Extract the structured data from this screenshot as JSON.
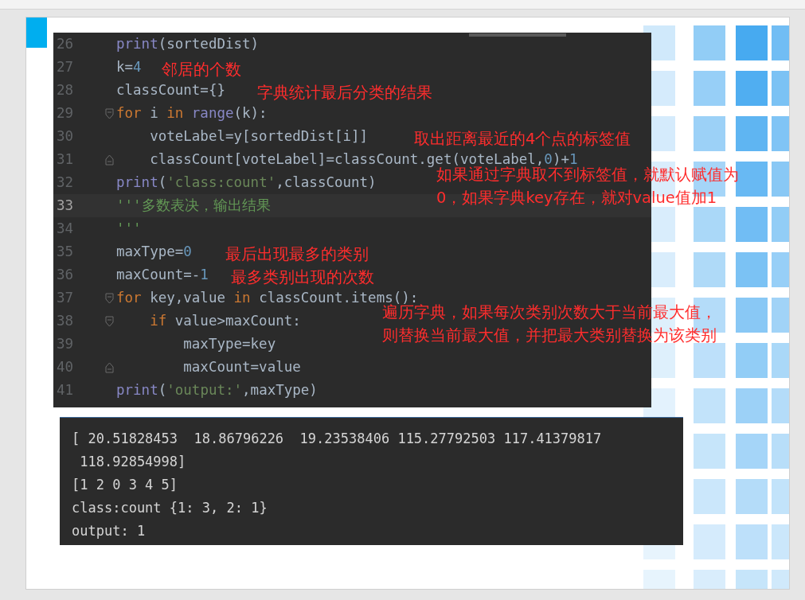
{
  "code_panel": {
    "lines": [
      {
        "number": "26",
        "kind": "plain",
        "current": false,
        "tokens": [
          {
            "kind": "builtin",
            "text": "print"
          },
          {
            "kind": "plain",
            "text": "(sortedDist)"
          }
        ]
      },
      {
        "number": "27",
        "kind": "plain",
        "current": false,
        "tokens": [
          {
            "kind": "plain",
            "text": "k="
          },
          {
            "kind": "number",
            "text": "4"
          }
        ]
      },
      {
        "number": "28",
        "kind": "plain",
        "current": false,
        "tokens": [
          {
            "kind": "plain",
            "text": "classCount={}"
          }
        ]
      },
      {
        "number": "29",
        "kind": "fold_start",
        "current": false,
        "tokens": [
          {
            "kind": "keyword",
            "text": "for"
          },
          {
            "kind": "plain",
            "text": " i "
          },
          {
            "kind": "keyword",
            "text": "in"
          },
          {
            "kind": "builtin",
            "text": " range"
          },
          {
            "kind": "plain",
            "text": "(k):"
          }
        ]
      },
      {
        "number": "30",
        "kind": "plain",
        "current": false,
        "tokens": [
          {
            "kind": "plain",
            "text": "    voteLabel=y[sortedDist[i]]"
          }
        ]
      },
      {
        "number": "31",
        "kind": "fold_end",
        "current": false,
        "tokens": [
          {
            "kind": "plain",
            "text": "    classCount[voteLabel]=classCount.get(voteLabel,"
          },
          {
            "kind": "number",
            "text": "0"
          },
          {
            "kind": "plain",
            "text": ")+"
          },
          {
            "kind": "number",
            "text": "1"
          }
        ]
      },
      {
        "number": "32",
        "kind": "plain",
        "current": false,
        "tokens": [
          {
            "kind": "builtin",
            "text": "print"
          },
          {
            "kind": "plain",
            "text": "("
          },
          {
            "kind": "string",
            "text": "'class:count'"
          },
          {
            "kind": "plain",
            "text": ",classCount)"
          }
        ]
      },
      {
        "number": "33",
        "kind": "plain",
        "current": true,
        "tokens": [
          {
            "kind": "docstring",
            "text": "'''多数表决，输出结果"
          }
        ]
      },
      {
        "number": "34",
        "kind": "plain",
        "current": false,
        "tokens": [
          {
            "kind": "docstring",
            "text": "'''"
          }
        ]
      },
      {
        "number": "35",
        "kind": "plain",
        "current": false,
        "tokens": [
          {
            "kind": "plain",
            "text": "maxType="
          },
          {
            "kind": "number",
            "text": "0"
          }
        ]
      },
      {
        "number": "36",
        "kind": "plain",
        "current": false,
        "tokens": [
          {
            "kind": "plain",
            "text": "maxCount=-"
          },
          {
            "kind": "number",
            "text": "1"
          }
        ]
      },
      {
        "number": "37",
        "kind": "fold_start",
        "current": false,
        "tokens": [
          {
            "kind": "keyword",
            "text": "for"
          },
          {
            "kind": "plain",
            "text": " key,value "
          },
          {
            "kind": "keyword",
            "text": "in"
          },
          {
            "kind": "plain",
            "text": " classCount.items():"
          }
        ]
      },
      {
        "number": "38",
        "kind": "fold_start",
        "current": false,
        "tokens": [
          {
            "kind": "keyword",
            "text": "    if"
          },
          {
            "kind": "plain",
            "text": " value>maxCount:"
          }
        ]
      },
      {
        "number": "39",
        "kind": "plain",
        "current": false,
        "tokens": [
          {
            "kind": "plain",
            "text": "        maxType=key"
          }
        ]
      },
      {
        "number": "40",
        "kind": "fold_end",
        "current": false,
        "tokens": [
          {
            "kind": "plain",
            "text": "        maxCount=value"
          }
        ]
      },
      {
        "number": "41",
        "kind": "plain",
        "current": false,
        "tokens": [
          {
            "kind": "builtin",
            "text": "print"
          },
          {
            "kind": "plain",
            "text": "("
          },
          {
            "kind": "string",
            "text": "'output:'"
          },
          {
            "kind": "plain",
            "text": ",maxType)"
          }
        ]
      }
    ]
  },
  "annotations": [
    {
      "lines": [
        "邻居的个数"
      ]
    },
    {
      "lines": [
        "字典统计最后分类的结果"
      ]
    },
    {
      "lines": [
        "取出距离最近的4个点的标签值"
      ]
    },
    {
      "lines": [
        "如果通过字典取不到标签值，就默认赋值为",
        "0，如果字典key存在，就对value值加1"
      ]
    },
    {
      "lines": [
        "最后出现最多的类别"
      ]
    },
    {
      "lines": [
        "最多类别出现的次数"
      ]
    },
    {
      "lines": [
        "遍历字典，如果每次类别次数大于当前最大值，",
        "则替换当前最大值，并把最大类别替换为该类别"
      ]
    }
  ],
  "output_panel": {
    "lines": [
      "[ 20.51828453  18.86796226  19.23538406 115.27792503 117.41379817",
      " 118.92854998]",
      "[1 2 0 3 4 5]",
      "class:count {1: 3, 2: 1}",
      "output: 1"
    ]
  }
}
